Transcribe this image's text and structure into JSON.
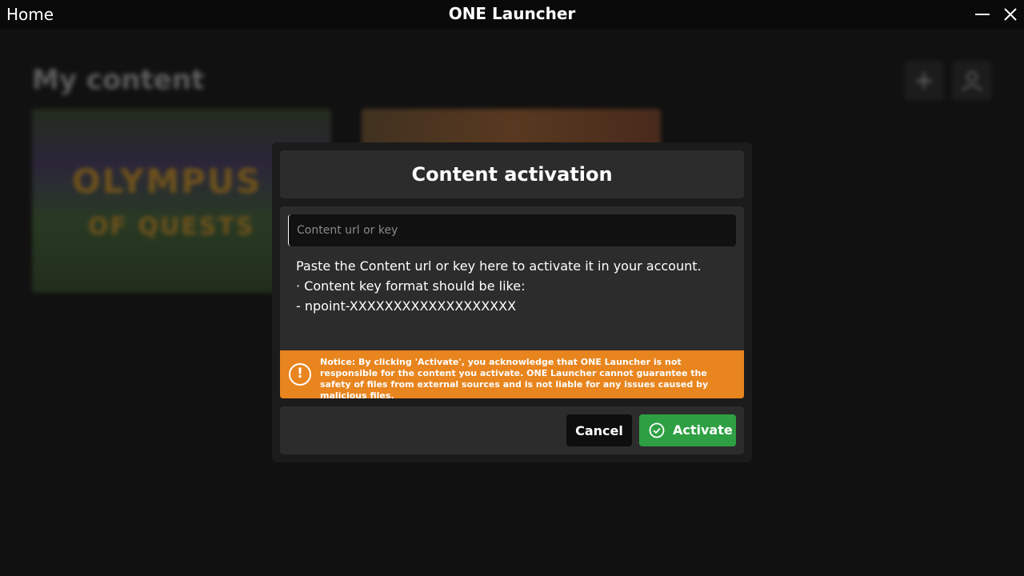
{
  "titlebar": {
    "home": "Home",
    "title": "ONE Launcher"
  },
  "background": {
    "heading": "My content",
    "card1_line1": "OLYMPUS",
    "card1_line2": "OF QUESTS"
  },
  "dialog": {
    "title": "Content activation",
    "input_placeholder": "Content url or key",
    "input_value": "",
    "help_line1": "Paste the Content url or key here to activate it in your account.",
    "help_line2": "· Content key format should be like:",
    "help_line3": "- npoint-XXXXXXXXXXXXXXXXXXX",
    "notice": "Notice: By clicking 'Activate', you acknowledge that ONE Launcher is not responsible for the content you activate. ONE Launcher cannot guarantee the safety of files from external sources and is not liable for any issues caused by malicious files.",
    "cancel_label": "Cancel",
    "activate_label": "Activate"
  },
  "colors": {
    "accent_green": "#2ea043",
    "notice_orange": "#e8851e"
  }
}
